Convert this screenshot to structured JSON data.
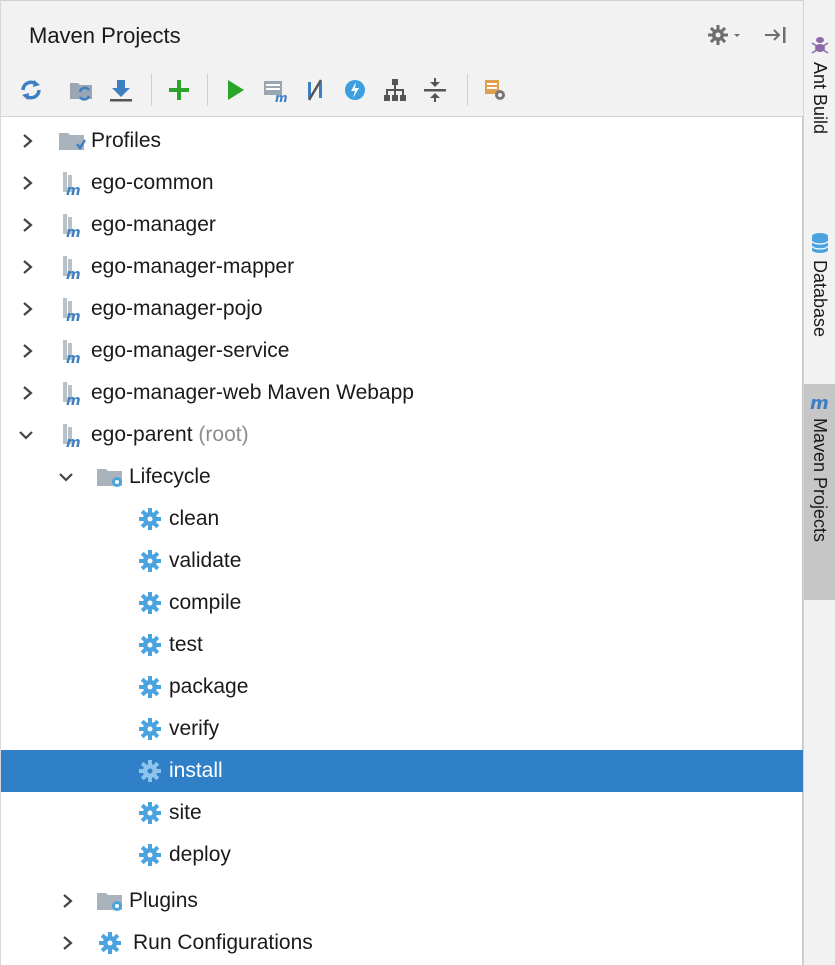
{
  "panel": {
    "title": "Maven Projects",
    "header_icons": [
      "gear-icon",
      "hide-panel-icon"
    ]
  },
  "toolbar": {
    "icons": [
      "reimport-icon",
      "generate-sources-icon",
      "download-icon",
      "add-icon",
      "run-icon",
      "execute-goal-icon",
      "skip-tests-icon",
      "offline-icon",
      "dependencies-icon",
      "collapse-all-icon",
      "settings-icon"
    ]
  },
  "tree": {
    "profiles": "Profiles",
    "modules": [
      "ego-common",
      "ego-manager",
      "ego-manager-mapper",
      "ego-manager-pojo",
      "ego-manager-service",
      "ego-manager-web Maven Webapp"
    ],
    "root_module": {
      "name": "ego-parent",
      "suffix": "(root)"
    },
    "lifecycle": {
      "label": "Lifecycle",
      "goals": [
        "clean",
        "validate",
        "compile",
        "test",
        "package",
        "verify",
        "install",
        "site",
        "deploy"
      ],
      "selected": "install"
    },
    "plugins": "Plugins",
    "run_configurations": "Run Configurations"
  },
  "side_tabs": [
    {
      "label": "Ant Build",
      "active": false
    },
    {
      "label": "Database",
      "active": false
    },
    {
      "label": "Maven Projects",
      "active": true
    }
  ],
  "colors": {
    "selection": "#2f80c6",
    "header_bg": "#f2f2f2",
    "gear_blue": "#4aa3df",
    "run_green": "#2aa52a",
    "folder_grey": "#a8b3bd"
  }
}
